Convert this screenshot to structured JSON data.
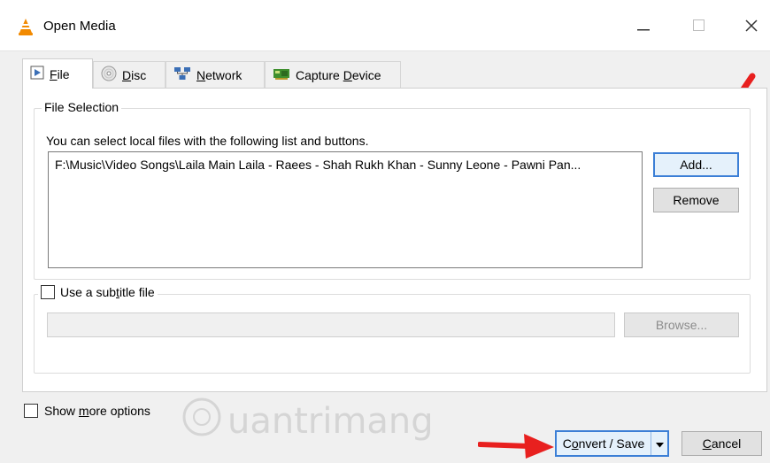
{
  "window": {
    "title": "Open Media",
    "icon": "vlc-cone-icon",
    "controls": [
      "minimize-icon",
      "maximize-icon",
      "close-icon"
    ]
  },
  "tabs": [
    {
      "label_pre": "",
      "mnemonic": "F",
      "label_post": "ile",
      "icon": "file-play-icon",
      "active": true
    },
    {
      "label_pre": "",
      "mnemonic": "D",
      "label_post": "isc",
      "icon": "disc-icon",
      "active": false
    },
    {
      "label_pre": "",
      "mnemonic": "N",
      "label_post": "etwork",
      "icon": "network-icon",
      "active": false
    },
    {
      "label_pre": "Capture ",
      "mnemonic": "D",
      "label_post": "evice",
      "icon": "capture-card-icon",
      "active": false
    }
  ],
  "file_selection": {
    "legend": "File Selection",
    "hint": "You can select local files with the following list and buttons.",
    "files": [
      "F:\\Music\\Video Songs\\Laila Main Laila - Raees - Shah Rukh Khan - Sunny Leone - Pawni Pan..."
    ],
    "add_label": "Add...",
    "remove_label": "Remove"
  },
  "subtitle": {
    "checkbox_pre": "Use a sub",
    "checkbox_mnemonic": "t",
    "checkbox_post": "itle file",
    "checked": false,
    "browse_label": "Browse...",
    "value": ""
  },
  "footer": {
    "more_pre": "Show ",
    "more_mnemonic": "m",
    "more_post": "ore options",
    "more_checked": false,
    "convert_pre": "C",
    "convert_mnemonic": "o",
    "convert_post": "nvert / Save",
    "cancel_mnemonic": "C",
    "cancel_post": "ancel"
  },
  "watermark": "uantrimang",
  "colors": {
    "accent": "#3c7fd6",
    "arrow": "#e8201f",
    "vlc_orange": "#f28a00"
  }
}
